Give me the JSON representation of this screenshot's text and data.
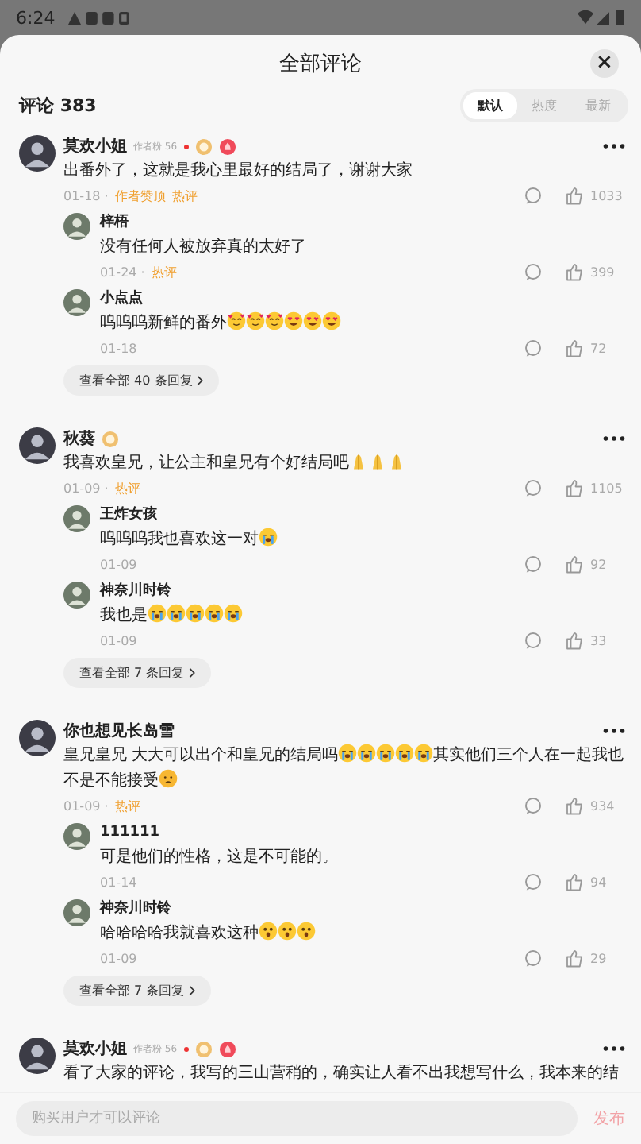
{
  "status_bar": {
    "time": "6:24"
  },
  "sheet": {
    "title": "全部评论",
    "close": "×"
  },
  "header": {
    "count_label": "评论 383",
    "sort_tabs": [
      {
        "label": "默认",
        "selected": true
      },
      {
        "label": "热度",
        "selected": false
      },
      {
        "label": "最新",
        "selected": false
      }
    ]
  },
  "comments": [
    {
      "name": "莫欢小姐",
      "tag": "作者粉 56",
      "badges": [
        {
          "kind": "medal"
        },
        {
          "kind": "flame"
        }
      ],
      "segments": [
        {
          "kind": "text",
          "text": "出番外了，这就是我心里最好的结局了，谢谢大家"
        }
      ],
      "date": "01-18 ·",
      "labels": [
        "作者赞顶",
        "热评"
      ],
      "likes": "1033",
      "replies": [
        {
          "name": "梓梧",
          "segments": [
            {
              "kind": "text",
              "text": "没有任何人被放弃真的太好了"
            }
          ],
          "date": "01-24 ·",
          "labels": [
            "热评"
          ],
          "likes": "399"
        },
        {
          "name": "小点点",
          "segments": [
            {
              "kind": "text",
              "text": "呜呜呜新鲜的番外"
            },
            {
              "kind": "love_emoji"
            },
            {
              "kind": "love_emoji"
            },
            {
              "kind": "love_emoji"
            },
            {
              "kind": "heart_eyes_emoji"
            },
            {
              "kind": "heart_eyes_emoji"
            },
            {
              "kind": "heart_eyes_emoji"
            }
          ],
          "date": "01-18",
          "likes": "72"
        }
      ],
      "more": "查看全部 40 条回复"
    },
    {
      "name": "秋葵",
      "badges": [
        {
          "kind": "medal"
        }
      ],
      "segments": [
        {
          "kind": "text",
          "text": "我喜欢皇兄，让公主和皇兄有个好结局吧"
        },
        {
          "kind": "pray_emoji"
        },
        {
          "kind": "pray_emoji"
        },
        {
          "kind": "pray_emoji"
        }
      ],
      "date": "01-09 ·",
      "labels": [
        "热评"
      ],
      "likes": "1105",
      "replies": [
        {
          "name": "王炸女孩",
          "segments": [
            {
              "kind": "text",
              "text": "呜呜呜我也喜欢这一对"
            },
            {
              "kind": "crying_emoji"
            }
          ],
          "date": "01-09",
          "likes": "92"
        },
        {
          "name": "神奈川时铃",
          "segments": [
            {
              "kind": "text",
              "text": "我也是"
            },
            {
              "kind": "crying_emoji"
            },
            {
              "kind": "crying_emoji"
            },
            {
              "kind": "crying_emoji"
            },
            {
              "kind": "crying_emoji"
            },
            {
              "kind": "crying_emoji"
            }
          ],
          "date": "01-09",
          "likes": "33"
        }
      ],
      "more": "查看全部 7 条回复"
    },
    {
      "name": "你也想见长岛雪",
      "segments": [
        {
          "kind": "text",
          "text": "皇兄皇兄 大大可以出个和皇兄的结局吗"
        },
        {
          "kind": "crying_emoji"
        },
        {
          "kind": "crying_emoji"
        },
        {
          "kind": "crying_emoji"
        },
        {
          "kind": "crying_emoji"
        },
        {
          "kind": "crying_emoji"
        },
        {
          "kind": "text",
          "text": "其实他们三个人在一起我也不是不能接受"
        },
        {
          "kind": "sad_emoji"
        }
      ],
      "date": "01-09 ·",
      "labels": [
        "热评"
      ],
      "likes": "934",
      "replies": [
        {
          "name": "111111",
          "segments": [
            {
              "kind": "text",
              "text": "可是他们的性格，这是不可能的。"
            }
          ],
          "date": "01-14",
          "likes": "94"
        },
        {
          "name": "神奈川时铃",
          "segments": [
            {
              "kind": "text",
              "text": "哈哈哈哈我就喜欢这种"
            },
            {
              "kind": "shocked_emoji"
            },
            {
              "kind": "shocked_emoji"
            },
            {
              "kind": "shocked_emoji"
            }
          ],
          "date": "01-09",
          "likes": "29"
        }
      ],
      "more": "查看全部 7 条回复"
    },
    {
      "name": "莫欢小姐",
      "tag": "作者粉 56",
      "badges": [
        {
          "kind": "medal"
        },
        {
          "kind": "flame"
        }
      ],
      "segments": [
        {
          "kind": "text",
          "text": "看了大家的评论，我写的三山营稍的，确实让人看不出我想写什么，我本来的结"
        }
      ]
    }
  ],
  "composer": {
    "placeholder": "购买用户才可以评论",
    "post": {
      "label": "发布",
      "disabled": true
    }
  }
}
